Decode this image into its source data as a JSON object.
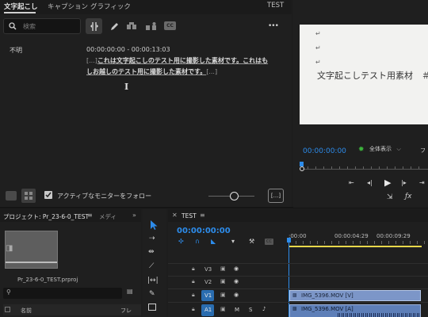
{
  "text_panel": {
    "tabs": [
      "文字起こし",
      "キャプション",
      "グラフィック"
    ],
    "sequence_name": "TEST",
    "search_placeholder": "検索",
    "more_label": "•••",
    "speaker": "不明",
    "timecode_range": "00:00:00:00 - 00:00:13:03",
    "ellipsis_start": "[...]",
    "transcript_text": "これは文字起こしのテスト用に撮影した素材です。これはもしお越しのテスト用に撮影した素材です。",
    "ellipsis_end": "[...]",
    "follow_monitor_label": "アクティブなモニターをフォロー",
    "follow_monitor_checked": true,
    "bottom_right_btn": "[...]"
  },
  "program_monitor": {
    "frame_lines": [
      "↵",
      "↵",
      "↵",
      "文字起こしテスト用素材　＃"
    ],
    "timecode": "00:00:00:00",
    "zoom_label": "全体表示",
    "partial_label": "フ"
  },
  "project_panel": {
    "title": "プロジェクト: Pr_23-6-0_TEST",
    "tab2": "メディ",
    "file_name": "Pr_23-6-0_TEST.prproj",
    "col_name": "名前",
    "col_fr": "フレ"
  },
  "timeline": {
    "seq_tab": "TEST",
    "timecode": "00:00:00:00",
    "ruler_labels": [
      ":00:00",
      "00:00:04:29",
      "00:00:09:29"
    ],
    "tracks": [
      {
        "name": "V3",
        "kind": "video"
      },
      {
        "name": "V2",
        "kind": "video"
      },
      {
        "name": "V1",
        "kind": "video",
        "active": true
      },
      {
        "name": "A1",
        "kind": "audio",
        "active": true
      }
    ],
    "clips": [
      {
        "label": "IMG_5396.MOV [V]",
        "track": "V1"
      },
      {
        "label": "IMG_5396.MOV [A]",
        "track": "A1"
      }
    ],
    "audio_btns": [
      "M",
      "S"
    ],
    "fx_label": "fx"
  }
}
